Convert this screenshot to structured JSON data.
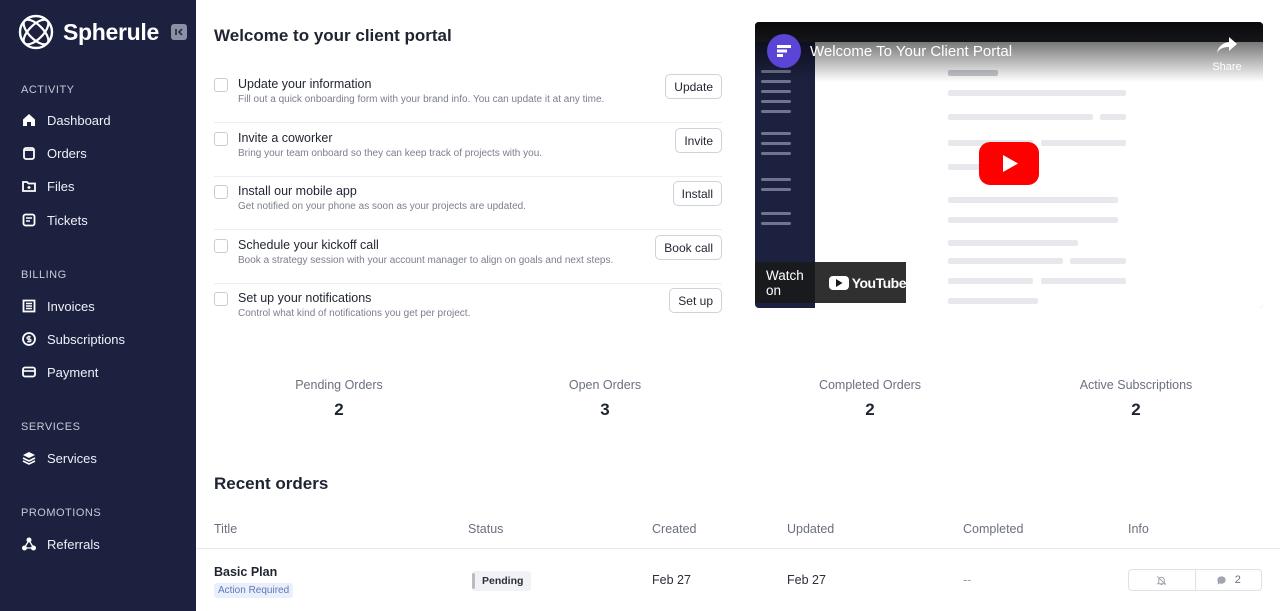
{
  "brand": {
    "name": "Spherule"
  },
  "sidebar": {
    "sections": [
      {
        "title": "ACTIVITY",
        "items": [
          {
            "label": "Dashboard",
            "icon": "home-icon"
          },
          {
            "label": "Orders",
            "icon": "orders-icon"
          },
          {
            "label": "Files",
            "icon": "folder-icon"
          },
          {
            "label": "Tickets",
            "icon": "ticket-icon"
          }
        ]
      },
      {
        "title": "BILLING",
        "items": [
          {
            "label": "Invoices",
            "icon": "invoice-icon"
          },
          {
            "label": "Subscriptions",
            "icon": "subscription-icon"
          },
          {
            "label": "Payment",
            "icon": "card-icon"
          }
        ]
      },
      {
        "title": "SERVICES",
        "items": [
          {
            "label": "Services",
            "icon": "layers-icon"
          }
        ]
      },
      {
        "title": "PROMOTIONS",
        "items": [
          {
            "label": "Referrals",
            "icon": "referral-icon"
          }
        ]
      }
    ]
  },
  "welcome": {
    "title": "Welcome to your client portal",
    "tasks": [
      {
        "title": "Update your information",
        "desc": "Fill out a quick onboarding form with your brand info. You can update it at any time.",
        "button": "Update"
      },
      {
        "title": "Invite a coworker",
        "desc": "Bring your team onboard so they can keep track of projects with you.",
        "button": "Invite"
      },
      {
        "title": "Install our mobile app",
        "desc": "Get notified on your phone as soon as your projects are updated.",
        "button": "Install"
      },
      {
        "title": "Schedule your kickoff call",
        "desc": "Book a strategy session with your account manager to align on goals and next steps.",
        "button": "Book call"
      },
      {
        "title": "Set up your notifications",
        "desc": "Control what kind of notifications you get per project.",
        "button": "Set up"
      }
    ]
  },
  "video": {
    "title": "Welcome To Your Client Portal",
    "share_label": "Share",
    "watch_on": "Watch on",
    "youtube": "YouTube"
  },
  "stats": [
    {
      "label": "Pending Orders",
      "value": "2"
    },
    {
      "label": "Open Orders",
      "value": "3"
    },
    {
      "label": "Completed Orders",
      "value": "2"
    },
    {
      "label": "Active Subscriptions",
      "value": "2"
    }
  ],
  "recent": {
    "title": "Recent orders",
    "columns": [
      "Title",
      "Status",
      "Created",
      "Updated",
      "Completed",
      "Info"
    ],
    "rows": [
      {
        "title": "Basic Plan",
        "badge": "Action Required",
        "status": "Pending",
        "created": "Feb 27",
        "updated": "Feb 27",
        "completed": "--",
        "comments": "2"
      }
    ]
  },
  "colors": {
    "sidebar_bg": "#1c2140",
    "accent": "#5b45d6",
    "youtube_red": "#ff0000"
  }
}
